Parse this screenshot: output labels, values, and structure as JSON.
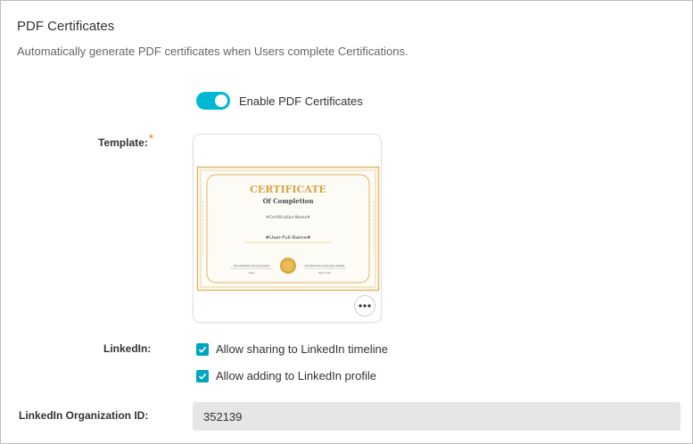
{
  "section": {
    "title": "PDF Certificates",
    "description": "Automatically generate PDF certificates when Users complete Certifications."
  },
  "enable_toggle": {
    "label": "Enable PDF Certificates",
    "on": true
  },
  "template": {
    "label": "Template:",
    "required_mark": "*",
    "preview": {
      "heading": "CERTIFICATE",
      "subheading": "Of Completion",
      "cert_name": "#Certification-Name#",
      "user_name": "#User-Full-Name#",
      "earned_date": "#Certification-Earned-Date#",
      "earned_caption": "Date",
      "expiration_date": "#Certification-Expiration-Date#",
      "expiration_caption": "Valid Until"
    },
    "more_icon": "more-horizontal-icon"
  },
  "linkedin": {
    "label": "LinkedIn:",
    "options": [
      {
        "label": "Allow sharing to LinkedIn timeline",
        "checked": true
      },
      {
        "label": "Allow adding to LinkedIn profile",
        "checked": true
      }
    ]
  },
  "org_id": {
    "label": "LinkedIn Organization ID:",
    "value": "352139"
  },
  "colors": {
    "accent": "#00b8d4",
    "checkbox": "#00a5bf",
    "required": "#f07b2a",
    "certificate_gold": "#d9a441"
  }
}
